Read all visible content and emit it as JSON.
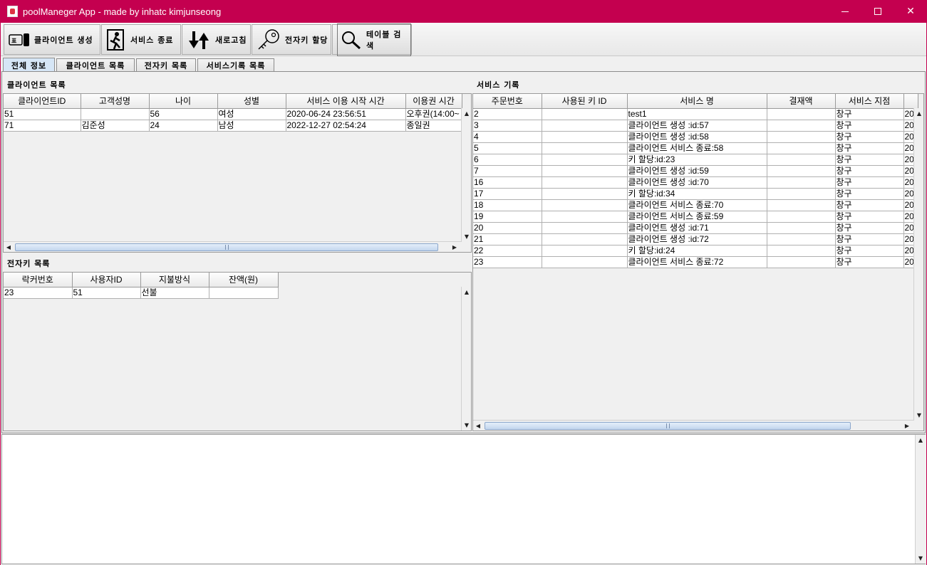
{
  "window": {
    "title": "poolManeger App - made by inhatc kimjunseong"
  },
  "toolbar": {
    "buttons": [
      {
        "label": "클라이언트 생성",
        "icon": "ticket-icon"
      },
      {
        "label": "서비스 종료",
        "icon": "exit-person-icon"
      },
      {
        "label": "새로고침",
        "icon": "refresh-arrows-icon"
      },
      {
        "label": "전자키 할당",
        "icon": "key-icon"
      },
      {
        "label": "테이블 검색",
        "icon": "magnifier-icon"
      }
    ]
  },
  "tabs": [
    "전체 정보",
    "클라이언트 목록",
    "전자키 목록",
    "서비스기록 목록"
  ],
  "clients": {
    "title": "클라이언트 목록",
    "columns": [
      "클라이언트ID",
      "고객성명",
      "나이",
      "성별",
      "서비스 이용 시작 시간",
      "이용권 시간"
    ],
    "rows": [
      [
        "51",
        "",
        "56",
        "여성",
        "2020-06-24 23:56:51",
        "오후권(14:00~"
      ],
      [
        "71",
        "김준성",
        "24",
        "남성",
        "2022-12-27 02:54:24",
        "종일권"
      ]
    ]
  },
  "keys": {
    "title": "전자키 목록",
    "columns": [
      "락커번호",
      "사용자ID",
      "지불방식",
      "잔액(원)"
    ],
    "rows": [
      [
        "23",
        "51",
        "선불",
        ""
      ]
    ]
  },
  "services": {
    "title": "서비스 기록",
    "columns": [
      "주문번호",
      "사용된 키 ID",
      "서비스 명",
      "결재액",
      "서비스 지점",
      ""
    ],
    "rows": [
      [
        "2",
        "",
        "test1",
        "",
        "창구",
        "20"
      ],
      [
        "3",
        "",
        "클라이언트 생성 :id:57",
        "",
        "창구",
        "20"
      ],
      [
        "4",
        "",
        "클라이언트 생성 :id:58",
        "",
        "창구",
        "20"
      ],
      [
        "5",
        "",
        "클라이언트 서비스 종료:58",
        "",
        "창구",
        "20"
      ],
      [
        "6",
        "",
        "키 할당:id:23",
        "",
        "창구",
        "20"
      ],
      [
        "7",
        "",
        "클라이언트 생성 :id:59",
        "",
        "창구",
        "20"
      ],
      [
        "16",
        "",
        "클라이언트 생성 :id:70",
        "",
        "창구",
        "20"
      ],
      [
        "17",
        "",
        "키 할당:id:34",
        "",
        "창구",
        "20"
      ],
      [
        "18",
        "",
        "클라이언트 서비스 종료:70",
        "",
        "창구",
        "20"
      ],
      [
        "19",
        "",
        "클라이언트 서비스 종료:59",
        "",
        "창구",
        "20"
      ],
      [
        "20",
        "",
        "클라이언트 생성 :id:71",
        "",
        "창구",
        "20"
      ],
      [
        "21",
        "",
        "클라이언트 생성 :id:72",
        "",
        "창구",
        "20"
      ],
      [
        "22",
        "",
        "키 할당:id:24",
        "",
        "창구",
        "20"
      ],
      [
        "23",
        "",
        "클라이언트 서비스 종료:72",
        "",
        "창구",
        "20"
      ]
    ]
  },
  "log": {
    "text": ""
  },
  "colors": {
    "titlebar": "#c4004f",
    "active_tab": "#d6e6f6"
  }
}
